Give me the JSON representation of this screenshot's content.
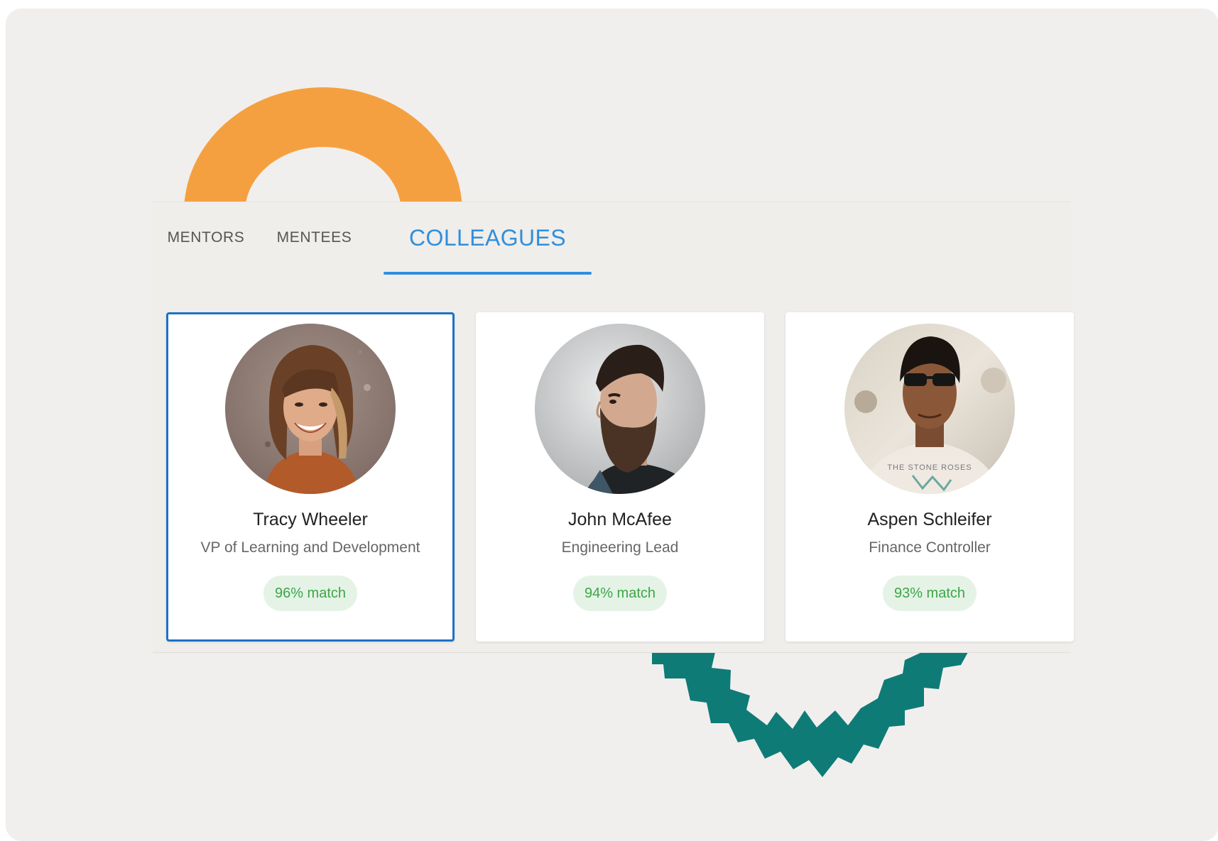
{
  "tabs": [
    {
      "label": "MENTORS",
      "active": false
    },
    {
      "label": "MENTEES",
      "active": false
    },
    {
      "label": "COLLEAGUES",
      "active": true
    }
  ],
  "colors": {
    "background": "#f1efed",
    "accent_blue": "#2f8fde",
    "selected_border": "#1d72c5",
    "match_text": "#3ea548",
    "match_bg": "#e4f3e6",
    "deco_orange": "#f5a040",
    "deco_teal": "#0e7b77"
  },
  "cards": [
    {
      "name": "Tracy Wheeler",
      "role": "VP of Learning and Development",
      "match": "96% match",
      "selected": true,
      "avatar": "woman-smiling-photo"
    },
    {
      "name": "John McAfee",
      "role": "Engineering Lead",
      "match": "94% match",
      "selected": false,
      "avatar": "bearded-man-photo"
    },
    {
      "name": "Aspen Schleifer",
      "role": "Finance Controller",
      "match": "93% match",
      "selected": false,
      "avatar": "man-sunglasses-photo",
      "shirt_text": "THE STONE ROSES"
    }
  ]
}
